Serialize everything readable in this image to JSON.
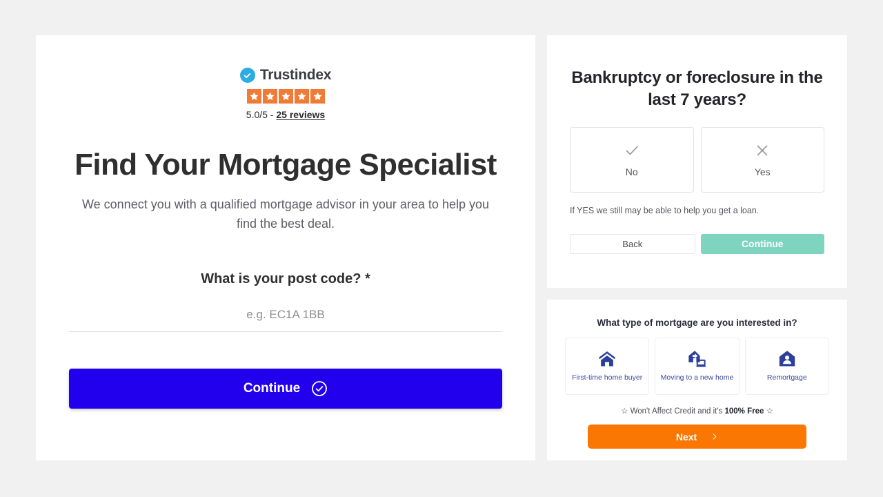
{
  "colors": {
    "page_background": "#f1f1f1",
    "primary_blue": "#2200ee",
    "trustindex_blue": "#2bace2",
    "star_orange": "#f07b36",
    "mint_green": "#7ed4bf",
    "orange": "#fb7703",
    "navy": "#3a4a9e"
  },
  "left_panel": {
    "trustindex": {
      "badge_icon": "check-badge-icon",
      "brand": "Trustindex",
      "star_icon": "star-icon",
      "star_count": 5,
      "rating_prefix": "5.0/5 - ",
      "reviews_link": "25 reviews"
    },
    "headline": "Find Your Mortgage Specialist",
    "subhead": "We connect you with a qualified mortgage advisor in your area to help you find the best deal.",
    "question_label": "What is your post code? *",
    "postcode": {
      "value": "",
      "placeholder": "e.g. EC1A 1BB"
    },
    "continue_label": "Continue",
    "continue_icon": "check-circle-icon"
  },
  "right_top_card": {
    "title": "Bankruptcy or foreclosure in the last 7 years?",
    "options": [
      {
        "label": "No",
        "icon": "check-icon"
      },
      {
        "label": "Yes",
        "icon": "close-icon"
      }
    ],
    "note": "If YES we still may be able to help you get a loan.",
    "back_label": "Back",
    "continue_label": "Continue"
  },
  "right_bottom_card": {
    "title": "What type of mortgage are you interested in?",
    "options": [
      {
        "label": "First-time home buyer",
        "icon": "house-icon"
      },
      {
        "label": "Moving to a new home",
        "icon": "house-moving-icon"
      },
      {
        "label": "Remortgage",
        "icon": "house-person-icon"
      }
    ],
    "free_note_prefix": "☆ Won't Affect Credit and it's ",
    "free_note_bold": "100% Free",
    "free_note_suffix": " ☆",
    "next_label": "Next",
    "next_icon": "chevron-right-icon"
  }
}
